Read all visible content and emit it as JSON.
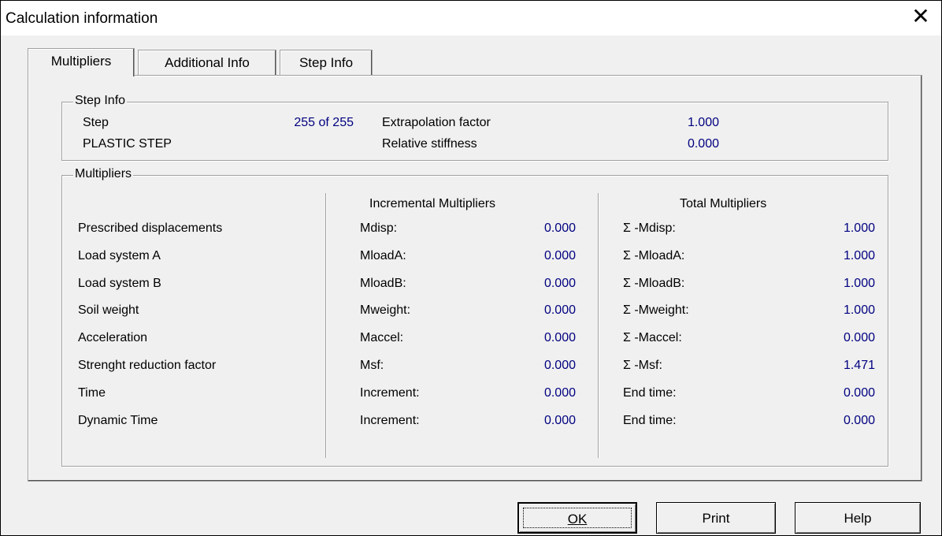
{
  "window": {
    "title": "Calculation information",
    "close_glyph": "✕"
  },
  "tabs": [
    {
      "label": "Multipliers",
      "active": true
    },
    {
      "label": "Additional Info",
      "active": false
    },
    {
      "label": "Step Info",
      "active": false
    }
  ],
  "step_info": {
    "legend": "Step Info",
    "step_label": "Step",
    "step_value": "255 of 255",
    "phase_label": "PLASTIC STEP",
    "extrapolation_label": "Extrapolation factor",
    "extrapolation_value": "1.000",
    "stiffness_label": "Relative stiffness",
    "stiffness_value": "0.000"
  },
  "multipliers": {
    "legend": "Multipliers",
    "incremental_header": "Incremental Multipliers",
    "total_header": "Total Multipliers",
    "rows": [
      {
        "name": "Prescribed displacements",
        "inc_label": "Mdisp:",
        "inc_value": "0.000",
        "total_label": "Σ -Mdisp:",
        "total_value": "1.000"
      },
      {
        "name": "Load system A",
        "inc_label": "MloadA:",
        "inc_value": "0.000",
        "total_label": "Σ -MloadA:",
        "total_value": "1.000"
      },
      {
        "name": "Load system B",
        "inc_label": "MloadB:",
        "inc_value": "0.000",
        "total_label": "Σ -MloadB:",
        "total_value": "1.000"
      },
      {
        "name": "Soil weight",
        "inc_label": "Mweight:",
        "inc_value": "0.000",
        "total_label": "Σ -Mweight:",
        "total_value": "1.000"
      },
      {
        "name": "Acceleration",
        "inc_label": "Maccel:",
        "inc_value": "0.000",
        "total_label": "Σ -Maccel:",
        "total_value": "0.000"
      },
      {
        "name": "Strenght reduction factor",
        "inc_label": "Msf:",
        "inc_value": "0.000",
        "total_label": "Σ -Msf:",
        "total_value": "1.471"
      },
      {
        "name": "Time",
        "inc_label": "Increment:",
        "inc_value": "0.000",
        "total_label": "End time:",
        "total_value": "0.000"
      },
      {
        "name": "Dynamic Time",
        "inc_label": "Increment:",
        "inc_value": "0.000",
        "total_label": "End time:",
        "total_value": "0.000"
      }
    ]
  },
  "buttons": {
    "ok_label": "OK",
    "print_label": "Print",
    "help_label": "Help"
  },
  "colors": {
    "value_text": "#000080",
    "dialog_bg": "#f0f0f0"
  }
}
